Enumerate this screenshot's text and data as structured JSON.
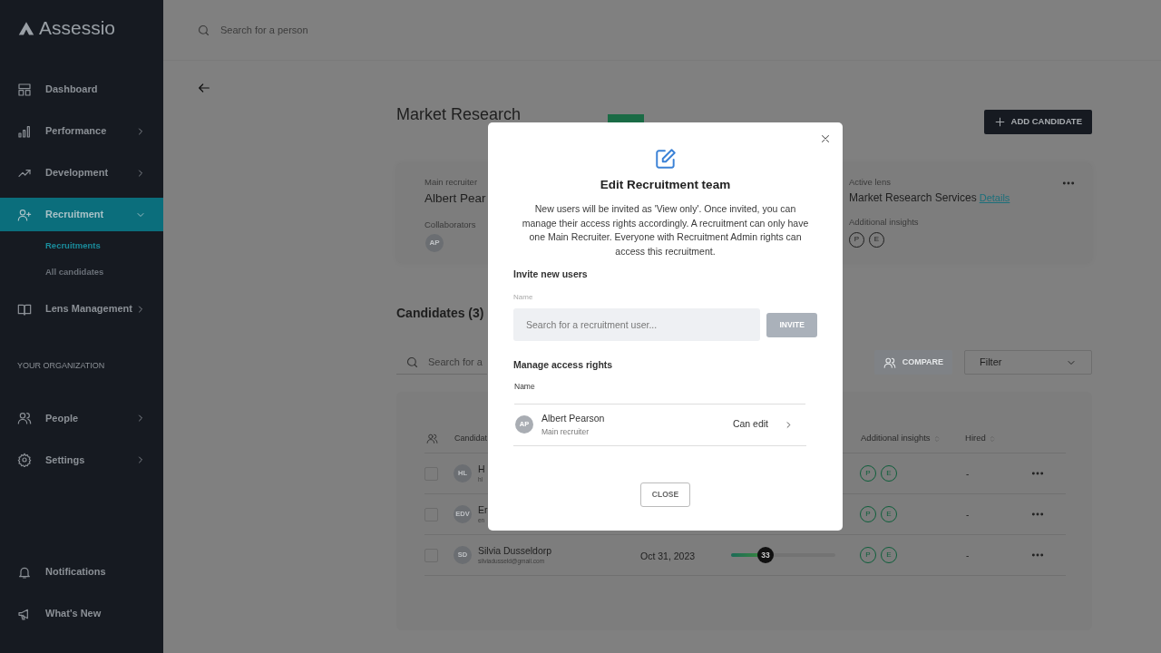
{
  "sidebar": {
    "logo": "Assessio",
    "items": [
      {
        "label": "Dashboard",
        "selected": false
      },
      {
        "label": "Performance",
        "selected": false,
        "expanded": false
      },
      {
        "label": "Development",
        "selected": false,
        "expanded": false
      },
      {
        "label": "Recruitment",
        "selected": true,
        "expanded": true,
        "children": [
          {
            "label": "Recruitments",
            "selected": true
          },
          {
            "label": "All candidates",
            "selected": false
          }
        ]
      },
      {
        "label": "Lens Management",
        "selected": false,
        "expanded": false
      }
    ],
    "section_label": "YOUR ORGANIZATION",
    "org_items": [
      {
        "label": "People",
        "selected": false,
        "expanded": false
      },
      {
        "label": "Settings",
        "selected": false,
        "expanded": false
      }
    ],
    "bottom_items": [
      {
        "label": "Notifications",
        "selected": false
      },
      {
        "label": "What's New",
        "selected": false
      }
    ]
  },
  "top_search": {
    "placeholder": "Search for a person"
  },
  "page": {
    "title": "Market Research",
    "add_button": "ADD CANDIDATE",
    "info": {
      "main_recruiter_label": "Main recruiter",
      "main_recruiter": "Albert Pear",
      "collaborators_label": "Collaborators",
      "collaborators": [
        "AP"
      ],
      "active_lens_label": "Active lens",
      "active_lens": "Market Research Services",
      "details_link": "Details",
      "insights_label": "Additional insights",
      "insights": [
        "P",
        "E"
      ]
    },
    "candidates_title": "Candidates (3)",
    "search": {
      "placeholder": "Search for a"
    },
    "compare_button": "COMPARE",
    "filter": "Filter",
    "table": {
      "columns": [
        "Candidat",
        "Additional insights",
        "Hired"
      ],
      "rows": [
        {
          "checked": false,
          "initials": "HL",
          "name": "H",
          "email": "hl",
          "insights": [
            "P",
            "E"
          ],
          "hired": "-"
        },
        {
          "checked": false,
          "initials": "EDV",
          "name": "Er",
          "email": "en",
          "insights": [
            "P",
            "E"
          ],
          "hired": "-"
        },
        {
          "checked": false,
          "initials": "SD",
          "name": "Silvia Dusseldorp",
          "email": "silviadusseld@gmail.com",
          "date": "Oct 31, 2023",
          "score": "33",
          "level": 0.33,
          "insights": [
            "P",
            "E"
          ],
          "hired": "-"
        }
      ]
    }
  },
  "modal": {
    "title": "Edit Recruitment team",
    "description": "New users will be invited as 'View only'. Once invited, you can manage their access rights accordingly. A recruitment can only have one Main Recruiter. Everyone with Recruitment Admin rights can access this recruitment.",
    "invite_heading": "Invite new users",
    "field_label": "Name",
    "field_placeholder": "Search for a recruitment user...",
    "invite_button": "INVITE",
    "invite_disabled": true,
    "manage_heading": "Manage access rights",
    "column": "Name",
    "members": [
      {
        "initials": "AP",
        "name": "Albert Pearson",
        "role": "Main recruiter",
        "rights": "Can edit"
      }
    ],
    "close_button": "CLOSE"
  }
}
